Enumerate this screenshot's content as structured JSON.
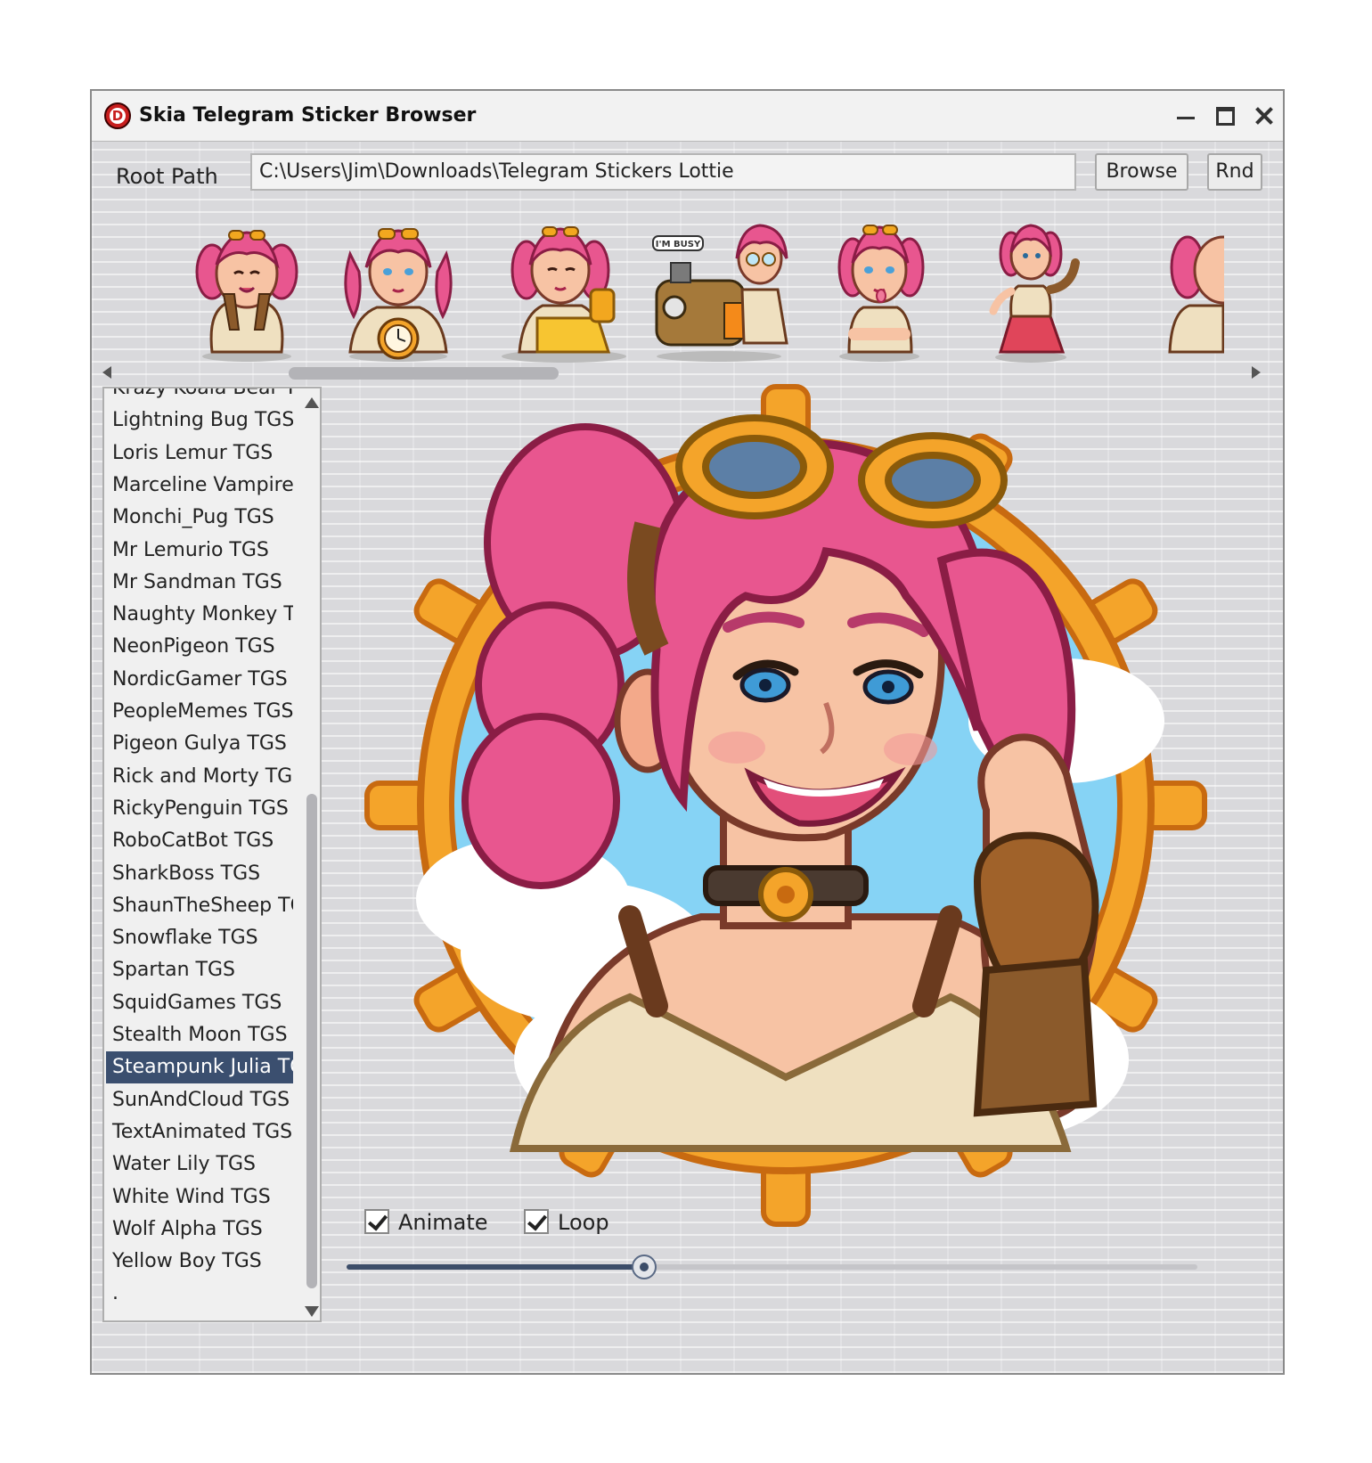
{
  "window": {
    "title": "Skia Telegram Sticker Browser",
    "icon": "app-logo-icon"
  },
  "toolbar": {
    "root_path_label": "Root Path",
    "root_path_value": "C:\\Users\\Jim\\Downloads\\Telegram Stickers Lottie",
    "browse_label": "Browse",
    "random_label": "Rnd"
  },
  "sticker_strip": {
    "thumbnails": [
      {
        "icon": "girl-hands-on-cheeks-sticker"
      },
      {
        "icon": "girl-with-pocket-watch-sticker"
      },
      {
        "icon": "girl-with-golden-gauntlet-sticker"
      },
      {
        "icon": "girl-with-machine-im-busy-sticker",
        "caption": "I'M BUSY"
      },
      {
        "icon": "girl-tongue-out-sticker"
      },
      {
        "icon": "girl-red-dress-flexing-sticker"
      },
      {
        "icon": "girl-partial-sticker"
      }
    ]
  },
  "sticker_list": {
    "items": [
      "Krazy Koala Bear TG",
      "Lightning Bug TGS",
      "Loris Lemur TGS",
      "Marceline Vampire (",
      "Monchi_Pug TGS",
      "Mr Lemurio TGS",
      "Mr Sandman TGS",
      "Naughty Monkey T(",
      "NeonPigeon TGS",
      "NordicGamer TGS",
      "PeopleMemes TGS",
      "Pigeon Gulya TGS",
      "Rick and Morty TGS",
      "RickyPenguin TGS",
      "RoboCatBot TGS",
      "SharkBoss TGS",
      "ShaunTheSheep TG",
      "Snowflake TGS",
      "Spartan TGS",
      "SquidGames TGS",
      "Stealth Moon TGS",
      "Steampunk Julia TG",
      "SunAndCloud TGS",
      "TextAnimated TGS",
      "Water Lily TGS",
      "White Wind TGS",
      "Wolf Alpha TGS",
      "Yellow Boy TGS",
      "."
    ],
    "selected": "Steampunk Julia TG"
  },
  "preview": {
    "icon": "steampunk-julia-portrait-sticker"
  },
  "controls": {
    "animate_label": "Animate",
    "animate_checked": true,
    "loop_label": "Loop",
    "loop_checked": true,
    "progress": 0.35
  },
  "colors": {
    "selection": "#3b4f6f",
    "hair": "#e8568f",
    "frame": "#f4a42a",
    "sky": "#86d3f5"
  }
}
